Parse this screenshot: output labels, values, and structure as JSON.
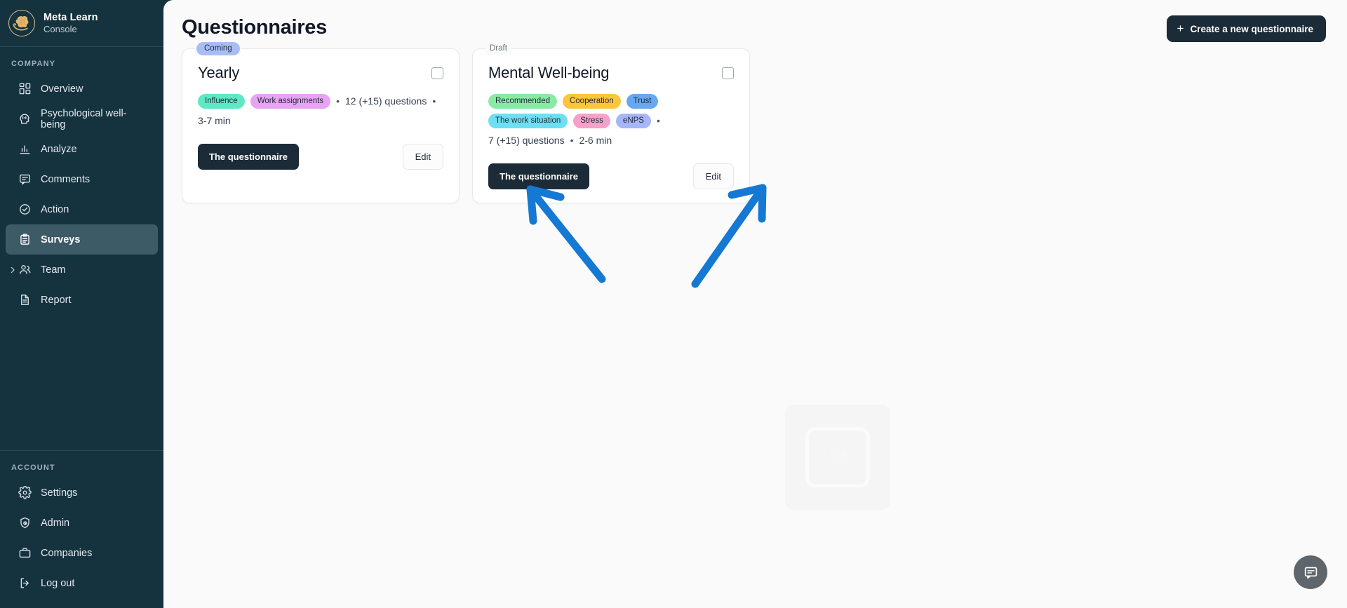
{
  "brand": {
    "name": "Meta Learn",
    "subtitle": "Console",
    "logo_icon": "brain-in-hand-logo"
  },
  "sidebar": {
    "company_label": "COMPANY",
    "account_label": "ACCOUNT",
    "company_items": [
      {
        "label": "Overview",
        "icon": "grid-icon",
        "active": false,
        "expandable": false
      },
      {
        "label": "Psychological well-being",
        "icon": "head-mind-icon",
        "active": false,
        "expandable": false
      },
      {
        "label": "Analyze",
        "icon": "bar-chart-icon",
        "active": false,
        "expandable": false
      },
      {
        "label": "Comments",
        "icon": "comment-icon",
        "active": false,
        "expandable": false
      },
      {
        "label": "Action",
        "icon": "check-circle-icon",
        "active": false,
        "expandable": false
      },
      {
        "label": "Surveys",
        "icon": "clipboard-icon",
        "active": true,
        "expandable": false
      },
      {
        "label": "Team",
        "icon": "users-icon",
        "active": false,
        "expandable": true
      },
      {
        "label": "Report",
        "icon": "document-icon",
        "active": false,
        "expandable": false
      }
    ],
    "account_items": [
      {
        "label": "Settings",
        "icon": "gear-icon"
      },
      {
        "label": "Admin",
        "icon": "shield-user-icon"
      },
      {
        "label": "Companies",
        "icon": "briefcase-icon"
      },
      {
        "label": "Log out",
        "icon": "logout-icon"
      }
    ]
  },
  "header": {
    "title": "Questionnaires",
    "create_button": "Create a new questionnaire",
    "create_button_icon": "plus-icon"
  },
  "cards": [
    {
      "status": "Coming",
      "status_style": "pill",
      "status_color": "#a9bdf5",
      "title": "Yearly",
      "checkbox_checked": false,
      "tags": [
        {
          "label": "Influence",
          "color": "#5fe8c4"
        },
        {
          "label": "Work assignments",
          "color": "#e6a4f2"
        }
      ],
      "separator": "•",
      "questions": "12 (+15) questions",
      "duration": "3-7 min",
      "primary_button": "The questionnaire",
      "secondary_button": "Edit"
    },
    {
      "status": "Draft",
      "status_style": "plain",
      "status_color": "#f2f2f2",
      "title": "Mental Well-being",
      "checkbox_checked": false,
      "tags": [
        {
          "label": "Recommended",
          "color": "#8aeaa4"
        },
        {
          "label": "Cooperation",
          "color": "#fbc63c"
        },
        {
          "label": "Trust",
          "color": "#68a8f0"
        },
        {
          "label": "The work situation",
          "color": "#6ddff2"
        },
        {
          "label": "Stress",
          "color": "#f7a0c9"
        },
        {
          "label": "eNPS",
          "color": "#a6b6fb"
        }
      ],
      "separator": "•",
      "questions": "7 (+15) questions",
      "duration": "2-6 min",
      "primary_button": "The questionnaire",
      "secondary_button": "Edit"
    }
  ],
  "annotations": {
    "color": "#1578d3",
    "arrows": [
      {
        "name": "arrow-to-yearly-card",
        "direction": "up-left"
      },
      {
        "name": "arrow-to-mental-wellbeing-card",
        "direction": "up-right"
      }
    ]
  },
  "widgets": {
    "chat_fab_icon": "chat-bubble-icon",
    "placeholder_text": "125"
  }
}
